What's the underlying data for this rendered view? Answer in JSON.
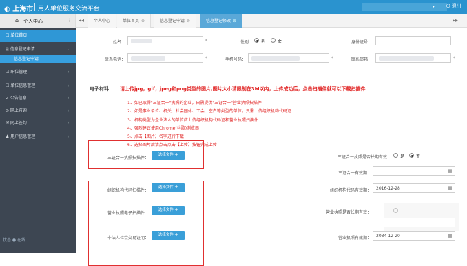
{
  "header": {
    "logo": "上海市",
    "title": "用人单位服务交流平台",
    "caret": "▾",
    "exit": "退出",
    "exit_icon": "power-icon"
  },
  "tabbar": {
    "home_icon": "home-icon",
    "personal_center": "个人中心",
    "toggle": "⫶",
    "prev": "◂◂",
    "next": "▸▸",
    "tabs": [
      {
        "label": "个人中心",
        "close": ""
      },
      {
        "label": "单位首页",
        "close": "⊗"
      },
      {
        "label": "信息登记申请",
        "close": "⊗"
      },
      {
        "label": "信息登记修改",
        "close": "⊗"
      }
    ]
  },
  "sidebar": {
    "items": [
      {
        "label": "☐ 单位首页",
        "chevron": ""
      },
      {
        "label": "🗎 信息登记申请",
        "chevron": "⌄"
      },
      {
        "label": "信息登记申请",
        "chevron": ""
      },
      {
        "label": "☑ 职位管理",
        "chevron": "‹"
      },
      {
        "label": "☐ 单位信息管理",
        "chevron": "‹"
      },
      {
        "label": "✓ 公告信息",
        "chevron": "‹"
      },
      {
        "label": "⊙ 网上咨询",
        "chevron": "‹"
      },
      {
        "label": "✉ 网上签约",
        "chevron": "‹"
      },
      {
        "label": "♟ 用户信息管理",
        "chevron": "‹"
      }
    ],
    "footer": "状态 ● 在线"
  },
  "form": {
    "name_label": "姓名：",
    "gender_label": "性别：",
    "gender_male": "男",
    "gender_female": "女",
    "id_label": "身份证号：",
    "phone_label": "联系电话：",
    "mobile_label": "手机号码：",
    "email_label": "联系邮箱：",
    "required": "*"
  },
  "materials": {
    "title": "电子材料",
    "hint": "请上传jpg，gif，jpeg和png类型的图片,图片大小请限制在3M以内，上传成功后，点击扫描件就可以下载扫描件",
    "notes": [
      "1、如已取得\"三证合一\"执照的企业，只需提供\"三证合一\"营业执照扫描件",
      "2、如是事业单位、机关、社会团体、工会、空白等类型的单位，只需上传组织机构代码证",
      "3、机构类型为企业法人的单位应上传组织机构代码证和营业执照扫描件",
      "4、强烈建议使用Chrome(谷歌)浏览器",
      "5、点击【图片】名字进行下载",
      "6、选择图片后请点击点击【上传】按钮完成上传"
    ],
    "upload_label": "选择文件 ✚",
    "three_in_one_label": "三证合一执照扫描件：",
    "three_in_one_expiry_label": "三证合一执照是否长期有效：",
    "yes": "是",
    "no": "否",
    "three_in_one_date_label": "三证合一有效期：",
    "org_code_label": "组织机构代码扫描件：",
    "org_code_date_label": "组织机构代码有效期：",
    "org_code_date": "2016-12-28",
    "license_label": "营业执照电子扫描件：",
    "license_expiry_label": "营业执照是否长期有效：",
    "legal_person_label": "非法人社会交易证明：",
    "license_date_label": "营业执照有效期：",
    "license_date": "2034-12-20",
    "calendar_icon": "calendar-icon"
  },
  "colors": {
    "brand_blue": "#2a93cf",
    "sidebar_bg": "#3d4652",
    "highlight_red": "#e03030",
    "button_blue": "#3a9fd8"
  }
}
